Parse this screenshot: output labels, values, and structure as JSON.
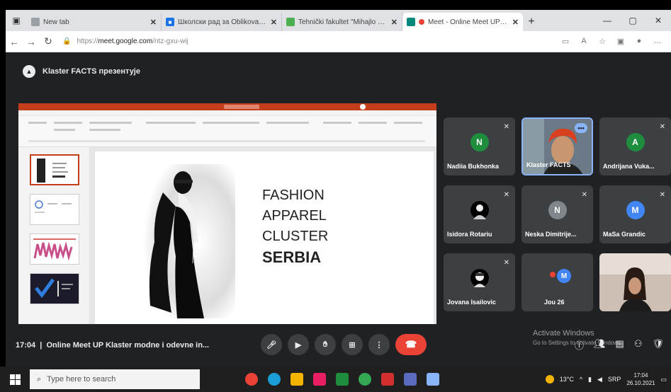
{
  "browser": {
    "tabs": [
      {
        "label": "New tab",
        "favicon_color": "#9aa0a6",
        "active": false
      },
      {
        "label": "Школски рад за Oblikovanje i t",
        "favicon_color": "#1a73e8",
        "active": false
      },
      {
        "label": "Tehnički fakultet \"Mihajlo Pupin\"",
        "favicon_color": "#4caf50",
        "active": false
      },
      {
        "label": "Meet - Online Meet UP Kl",
        "favicon_color": "#00897b",
        "active": true
      }
    ],
    "url_prefix": "https://",
    "url_host": "meet.google.com",
    "url_path": "/ntz-gxu-wij"
  },
  "meet": {
    "presenter_banner": "Klaster FACTS презентује",
    "time": "17:04",
    "separator": "|",
    "meeting_title": "Online Meet UP Klaster modne i odevne in...",
    "participants": [
      {
        "name": "Nadiia Bukhonka",
        "initial": "N",
        "avatar_color": "#1e8e3e",
        "type": "avatar"
      },
      {
        "name": "Klaster FACTS",
        "initial": "",
        "avatar_color": "",
        "type": "video",
        "highlighted": true
      },
      {
        "name": "Andrijana Vuka...",
        "initial": "A",
        "avatar_color": "#1e8e3e",
        "type": "avatar"
      },
      {
        "name": "Isidora Rotariu",
        "initial": "",
        "avatar_color": "#000000",
        "type": "photo"
      },
      {
        "name": "Neska Dimitrije...",
        "initial": "N",
        "avatar_color": "#80868b",
        "type": "avatar"
      },
      {
        "name": "MaSa Grandic",
        "initial": "M",
        "avatar_color": "#4285f4",
        "type": "avatar"
      },
      {
        "name": "Jovana Isailovic",
        "initial": "",
        "avatar_color": "#000000",
        "type": "photo"
      },
      {
        "name": "Jou 26",
        "initial": "M",
        "avatar_color": "#4285f4",
        "type": "avatar"
      },
      {
        "name": "",
        "initial": "",
        "avatar_color": "",
        "type": "video"
      }
    ],
    "slide": {
      "lines": [
        "FASHION",
        "APPAREL",
        "CLUSTER"
      ],
      "bold_line": "SERBIA"
    },
    "watermark": {
      "title": "Activate Windows",
      "subtitle": "Go to Settings to activate Windows."
    }
  },
  "taskbar": {
    "search_placeholder": "Type here to search",
    "temperature": "13°C",
    "language": "SRP",
    "clock_time": "17:04",
    "clock_date": "26.10.2021"
  }
}
